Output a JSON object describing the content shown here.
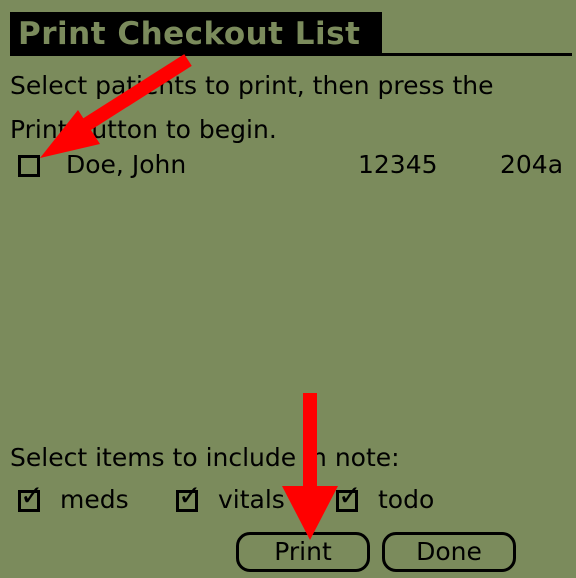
{
  "window": {
    "title": "Print Checkout List"
  },
  "instructions": "Select patients to print, then press the\nPrint button to begin.",
  "patients": [
    {
      "name": "Doe, John",
      "id": "12345",
      "room": "204a",
      "checked": false
    }
  ],
  "include": {
    "label": "Select items to include in note:",
    "options": [
      {
        "label": "meds",
        "checked": true,
        "check_glyph": "✓"
      },
      {
        "label": "vitals",
        "checked": true,
        "check_glyph": "✓"
      },
      {
        "label": "todo",
        "checked": true,
        "check_glyph": "✓"
      }
    ]
  },
  "buttons": {
    "print": "Print",
    "done": "Done"
  },
  "colors": {
    "lcd_background": "#7b8b5c",
    "foreground": "#000000",
    "annotation_arrow": "#ff0000"
  }
}
